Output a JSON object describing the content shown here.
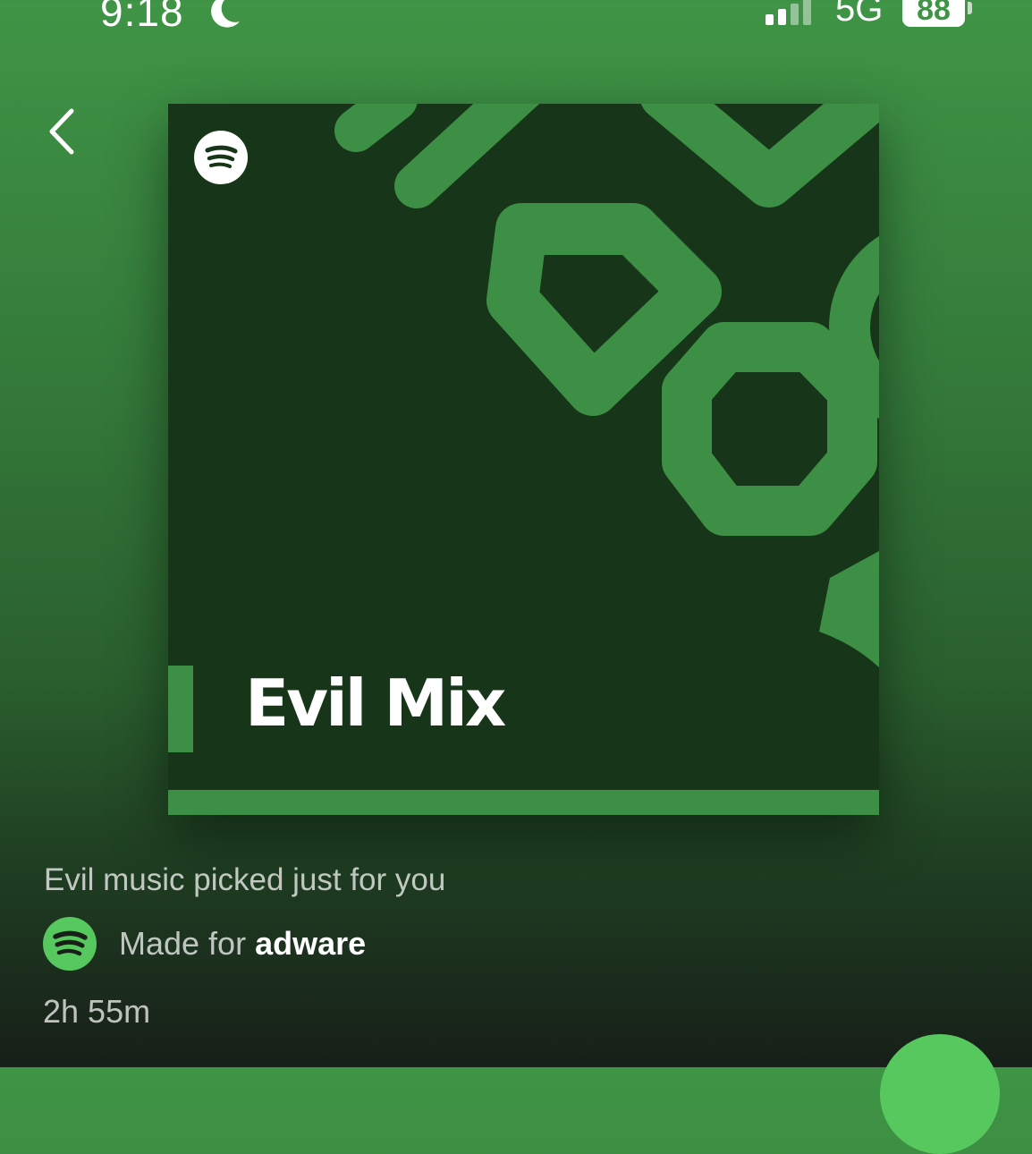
{
  "status_bar": {
    "time": "9:18",
    "network": "5G",
    "battery": "88"
  },
  "cover": {
    "title": "Evil Mix"
  },
  "playlist": {
    "description": "Evil music picked just for you",
    "made_for_prefix": "Made for ",
    "made_for_user": "adware",
    "duration": "2h 55m"
  },
  "colors": {
    "brand_green": "#3c8f44",
    "cover_dark": "#173518",
    "play_green": "#56c85e"
  },
  "icons": [
    "moon-icon",
    "signal-icon",
    "chevron-left-icon",
    "spotify-logo-icon",
    "play-icon"
  ]
}
